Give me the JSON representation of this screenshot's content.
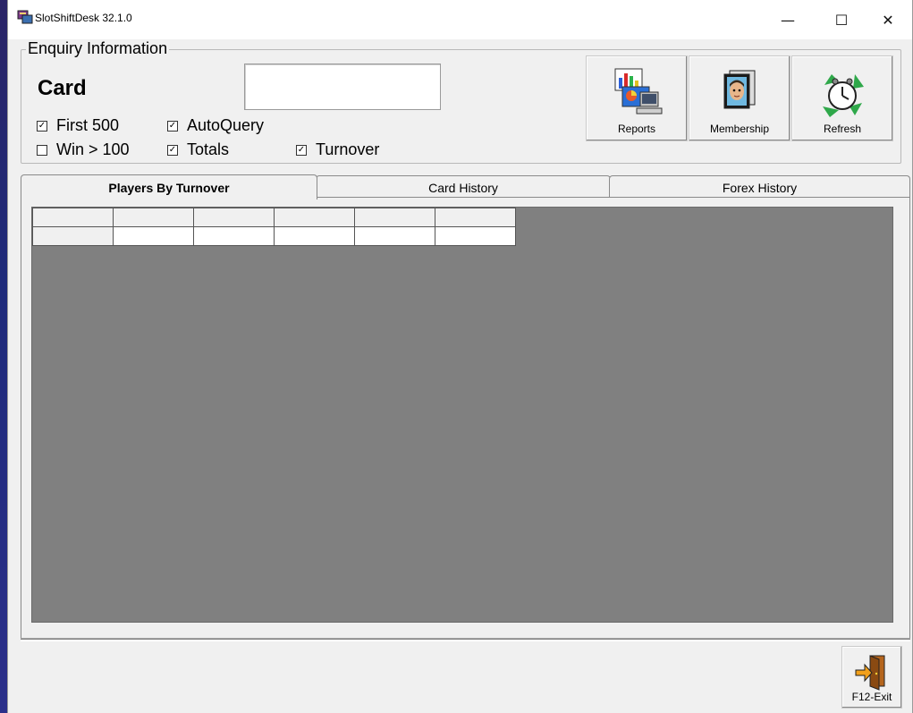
{
  "window": {
    "title": "SlotShiftDesk 32.1.0",
    "minimize_glyph": "—",
    "maximize_glyph": "☐",
    "close_glyph": "✕"
  },
  "enquiry": {
    "legend": "Enquiry Information",
    "card_label": "Card",
    "card_value": "",
    "checkboxes": {
      "first500": {
        "label": "First 500",
        "checked": true
      },
      "autoquery": {
        "label": "AutoQuery",
        "checked": true
      },
      "win100": {
        "label": "Win > 100",
        "checked": false
      },
      "totals": {
        "label": "Totals",
        "checked": true
      },
      "turnover": {
        "label": "Turnover",
        "checked": true
      }
    }
  },
  "toolbar": {
    "reports_label": "Reports",
    "reports_icon": "reports-computer-icon",
    "membership_label": "Membership",
    "membership_icon": "member-portrait-icon",
    "refresh_label": "Refresh",
    "refresh_icon": "recycle-clock-icon"
  },
  "tabs": [
    {
      "label": "Players By Turnover",
      "active": true
    },
    {
      "label": "Card History",
      "active": false
    },
    {
      "label": "Forex History",
      "active": false
    }
  ],
  "grid": {
    "columns": [
      "",
      "",
      "",
      "",
      "",
      ""
    ],
    "rows": [
      [
        "",
        "",
        "",
        "",
        "",
        ""
      ]
    ]
  },
  "footer": {
    "exit_label": "F12-Exit",
    "exit_icon": "exit-door-icon"
  }
}
